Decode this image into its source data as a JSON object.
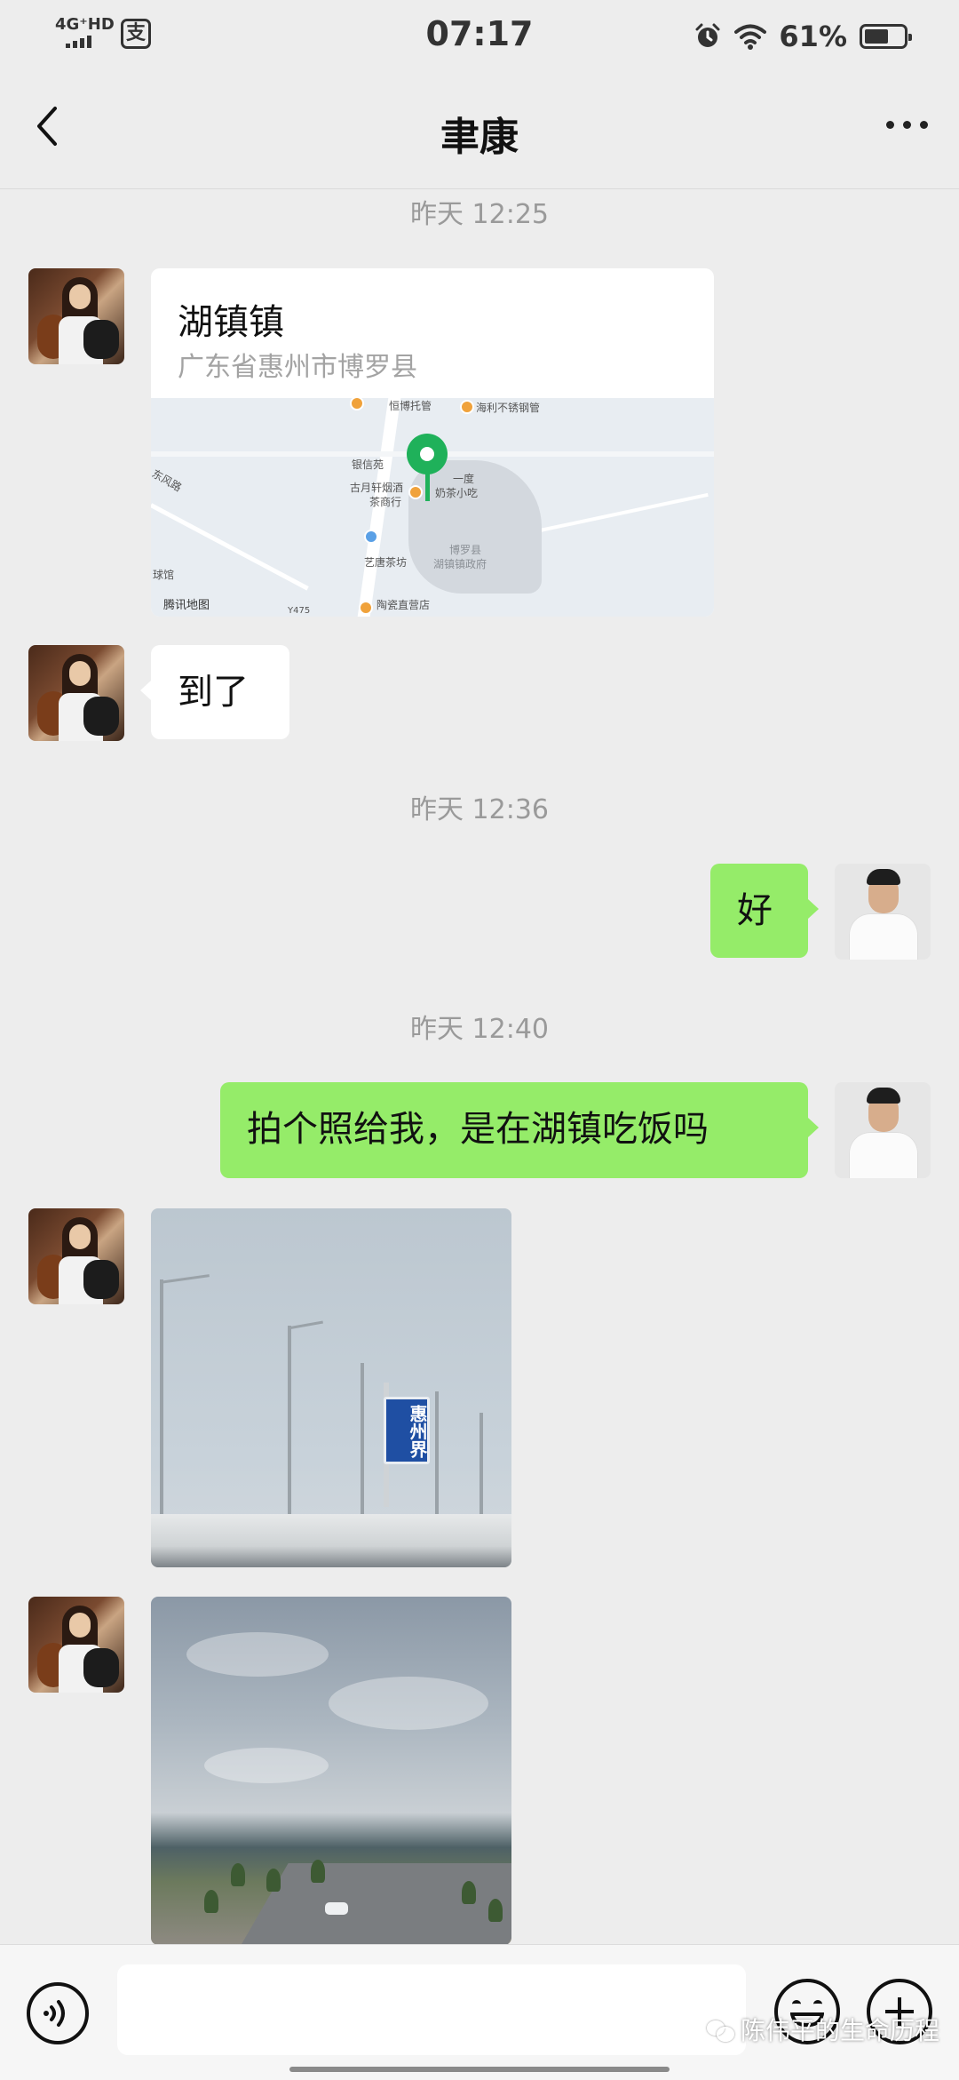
{
  "status_bar": {
    "network": "4G⁺HD",
    "carrier_app_icon": "支",
    "time": "07:17",
    "battery_percent": "61%",
    "battery_level": 0.61
  },
  "header": {
    "title": "聿康",
    "back_icon": "chevron-left-icon",
    "more_icon": "more-dots-icon"
  },
  "timestamps": [
    "昨天 12:25",
    "昨天 12:36",
    "昨天 12:40"
  ],
  "location_card": {
    "title": "湖镇镇",
    "address": "广东省惠州市博罗县",
    "map_labels": [
      "恒博托管",
      "海利不锈钢管",
      "银信苑",
      "古月轩烟酒",
      "茶商行",
      "一度",
      "奶茶小吃",
      "艺唐茶坊",
      "博罗县",
      "湖镇镇政府",
      "陶瓷直营店",
      "东风路",
      "球馆",
      "Y475"
    ],
    "map_brand": "腾讯地图"
  },
  "messages": {
    "arrived": "到了",
    "ok": "好",
    "request": "拍个照给我，是在湖镇吃饭吗"
  },
  "photo1": {
    "sign_text": "惠州界"
  },
  "input_bar": {
    "placeholder": ""
  },
  "watermark": "陈伟平的生命历程"
}
